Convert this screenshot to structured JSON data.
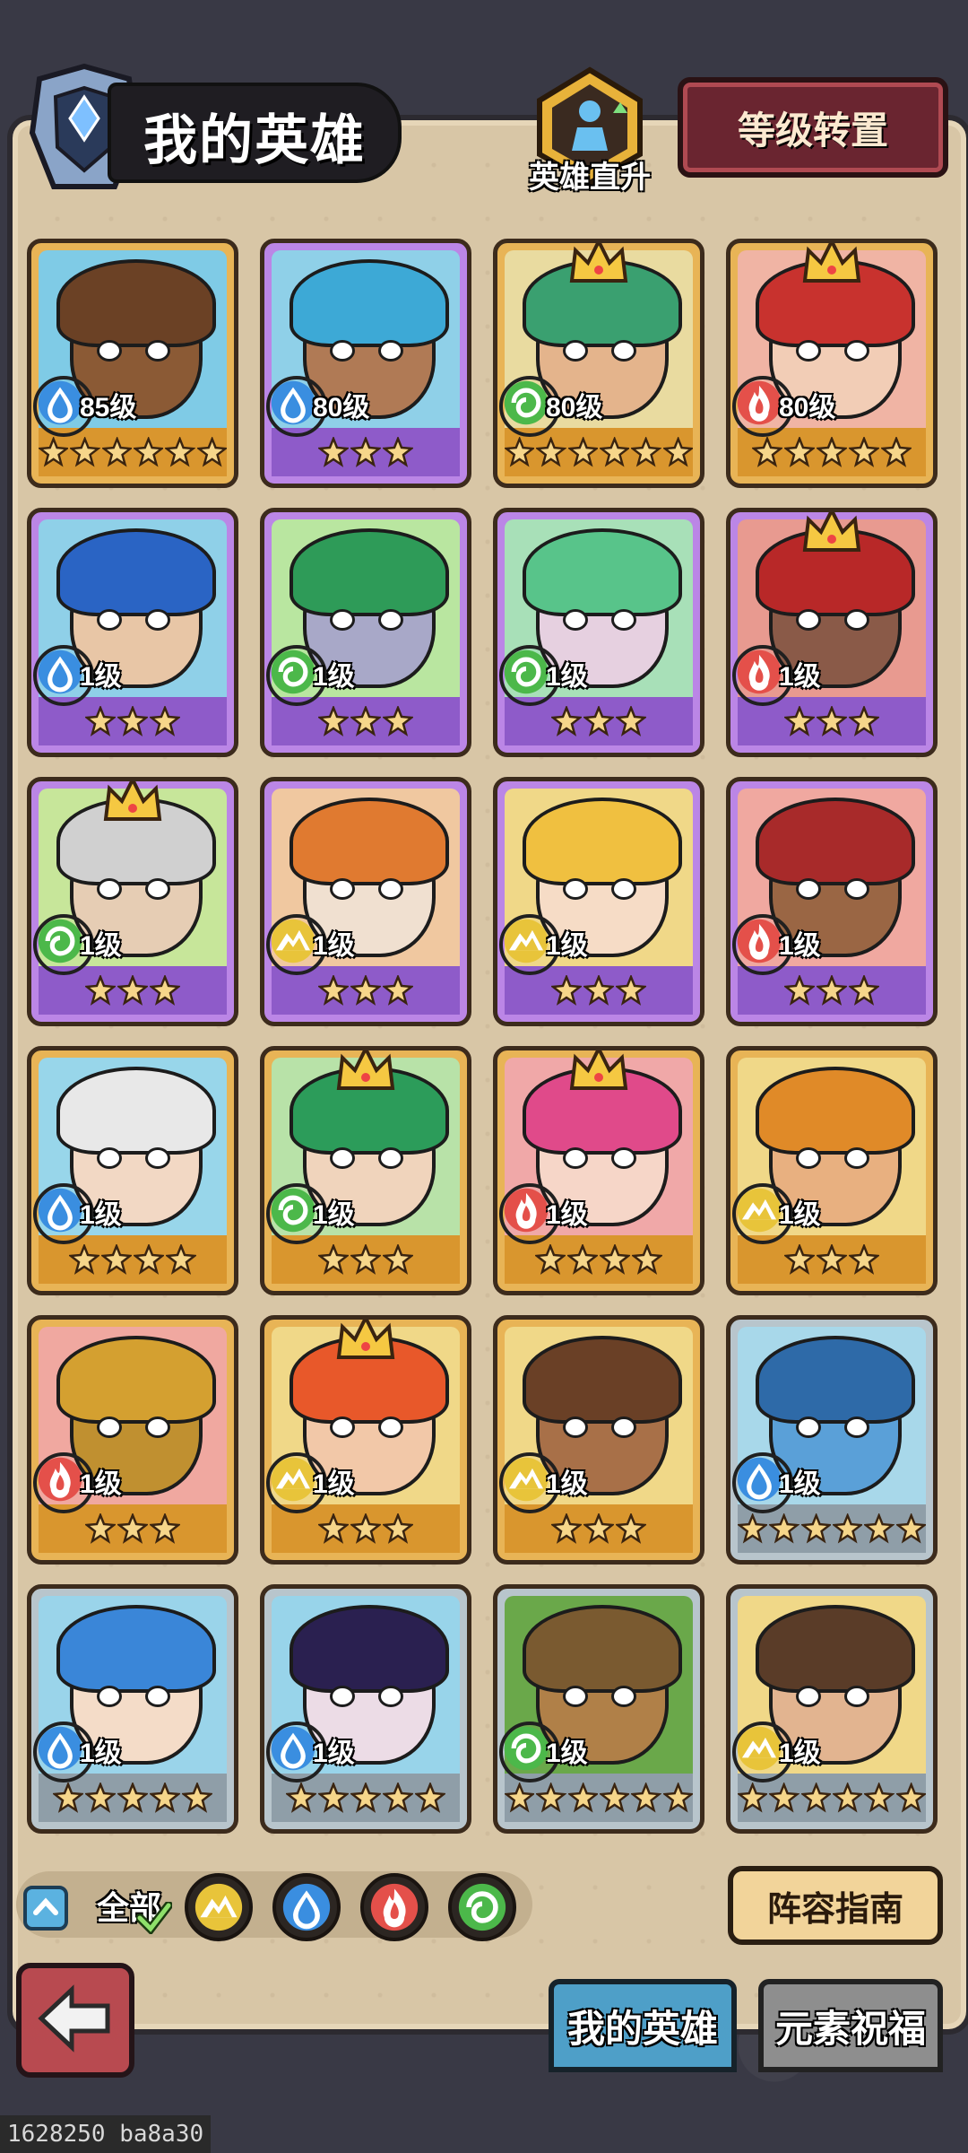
{
  "header": {
    "title": "我的英雄",
    "direct_upgrade_label": "英雄直升",
    "level_transfer_label": "等级转置"
  },
  "heroes": [
    {
      "level": "85级",
      "element": "water",
      "stars": 6,
      "rarity": "gold",
      "crown": false,
      "bg": "#7fcbe6",
      "skin": "#8b5a35",
      "hair": "#6b4125"
    },
    {
      "level": "80级",
      "element": "water",
      "stars": 3,
      "rarity": "purple",
      "crown": false,
      "bg": "#8fd0e8",
      "skin": "#b07a55",
      "hair": "#3da9d6"
    },
    {
      "level": "80级",
      "element": "wind",
      "stars": 6,
      "rarity": "gold",
      "crown": true,
      "bg": "#e9dba0",
      "skin": "#e4b48c",
      "hair": "#3aa070"
    },
    {
      "level": "80级",
      "element": "fire",
      "stars": 5,
      "rarity": "gold",
      "crown": true,
      "bg": "#f0b4a4",
      "skin": "#f2cdb6",
      "hair": "#c8322e"
    },
    {
      "level": "1级",
      "element": "water",
      "stars": 3,
      "rarity": "purple",
      "crown": false,
      "bg": "#8fd0e8",
      "skin": "#e8c6a6",
      "hair": "#2a64c4"
    },
    {
      "level": "1级",
      "element": "wind",
      "stars": 3,
      "rarity": "purple",
      "crown": false,
      "bg": "#b9e6a0",
      "skin": "#a8a8c8",
      "hair": "#2e9b58"
    },
    {
      "level": "1级",
      "element": "wind",
      "stars": 3,
      "rarity": "purple",
      "crown": false,
      "bg": "#a8e0b8",
      "skin": "#e6d0e0",
      "hair": "#58c48a"
    },
    {
      "level": "1级",
      "element": "fire",
      "stars": 3,
      "rarity": "purple",
      "crown": true,
      "bg": "#e89a90",
      "skin": "#8a5a48",
      "hair": "#b82828"
    },
    {
      "level": "1级",
      "element": "wind",
      "stars": 3,
      "rarity": "purple",
      "crown": true,
      "bg": "#c7e69a",
      "skin": "#e6cdb4",
      "hair": "#d0d0d0"
    },
    {
      "level": "1级",
      "element": "earth",
      "stars": 3,
      "rarity": "purple",
      "crown": false,
      "bg": "#f0c8a0",
      "skin": "#f0e0d0",
      "hair": "#e07a30"
    },
    {
      "level": "1级",
      "element": "earth",
      "stars": 3,
      "rarity": "purple",
      "crown": false,
      "bg": "#f0d888",
      "skin": "#f6dcc6",
      "hair": "#f0c040"
    },
    {
      "level": "1级",
      "element": "fire",
      "stars": 3,
      "rarity": "purple",
      "crown": false,
      "bg": "#f0a8a0",
      "skin": "#9a6644",
      "hair": "#a82a2a"
    },
    {
      "level": "1级",
      "element": "water",
      "stars": 4,
      "rarity": "gold",
      "crown": false,
      "bg": "#98d6ea",
      "skin": "#f2d8c4",
      "hair": "#e8e8e8"
    },
    {
      "level": "1级",
      "element": "wind",
      "stars": 3,
      "rarity": "gold",
      "crown": true,
      "bg": "#b8e2a8",
      "skin": "#f0d4bc",
      "hair": "#2c9c5a"
    },
    {
      "level": "1级",
      "element": "fire",
      "stars": 4,
      "rarity": "gold",
      "crown": true,
      "bg": "#f0a8a8",
      "skin": "#f6d6c8",
      "hair": "#e04a8a"
    },
    {
      "level": "1级",
      "element": "earth",
      "stars": 3,
      "rarity": "gold",
      "crown": false,
      "bg": "#f0d888",
      "skin": "#e8b080",
      "hair": "#e08a28"
    },
    {
      "level": "1级",
      "element": "fire",
      "stars": 3,
      "rarity": "gold",
      "crown": false,
      "bg": "#f0a8a0",
      "skin": "#c09030",
      "hair": "#d4a030"
    },
    {
      "level": "1级",
      "element": "earth",
      "stars": 3,
      "rarity": "gold",
      "crown": true,
      "bg": "#f0d888",
      "skin": "#f2c8a8",
      "hair": "#e8582a"
    },
    {
      "level": "1级",
      "element": "earth",
      "stars": 3,
      "rarity": "gold",
      "crown": false,
      "bg": "#f0d888",
      "skin": "#a87048",
      "hair": "#6a4026"
    },
    {
      "level": "1级",
      "element": "water",
      "stars": 6,
      "rarity": "silver",
      "crown": false,
      "bg": "#a8d8ea",
      "skin": "#5aa0d8",
      "hair": "#2e6aa8"
    },
    {
      "level": "1级",
      "element": "water",
      "stars": 5,
      "rarity": "silver",
      "crown": false,
      "bg": "#9ad4ea",
      "skin": "#f4dcc8",
      "hair": "#3a86d8"
    },
    {
      "level": "1级",
      "element": "water",
      "stars": 5,
      "rarity": "silver",
      "crown": false,
      "bg": "#98d4ea",
      "skin": "#ecdce6",
      "hair": "#2a2050"
    },
    {
      "level": "1级",
      "element": "wind",
      "stars": 6,
      "rarity": "silver",
      "crown": false,
      "bg": "#6aa84a",
      "skin": "#b08048",
      "hair": "#7a5a30"
    },
    {
      "level": "1级",
      "element": "earth",
      "stars": 6,
      "rarity": "silver",
      "crown": false,
      "bg": "#f0d888",
      "skin": "#e2b490",
      "hair": "#5a3c28"
    }
  ],
  "elements": {
    "water": {
      "color": "#3a8ee0",
      "glyph": "💧"
    },
    "wind": {
      "color": "#4cb84a",
      "glyph": "🌀"
    },
    "fire": {
      "color": "#e4504a",
      "glyph": "🔥"
    },
    "earth": {
      "color": "#e8c43a",
      "glyph": "⛰"
    }
  },
  "filters": {
    "all_label": "全部",
    "items": [
      "earth",
      "water",
      "fire",
      "wind"
    ]
  },
  "guide_button_label": "阵容指南",
  "tabs": {
    "my_heroes": "我的英雄",
    "element_blessing": "元素祝福"
  },
  "debug_label": "1628250 ba8a30"
}
